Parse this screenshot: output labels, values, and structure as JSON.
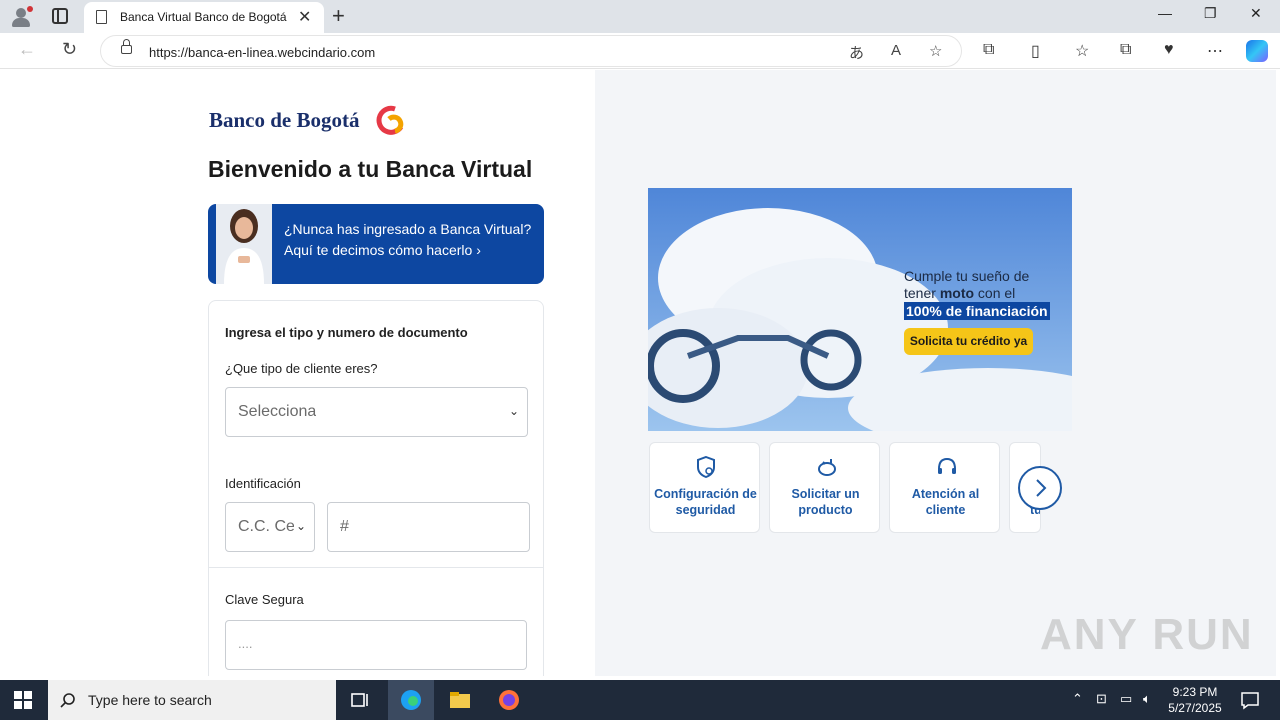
{
  "browser": {
    "tab_title": "Banca Virtual Banco de Bogotá",
    "url": "https://banca-en-linea.webcindario.com"
  },
  "page": {
    "logo_text": "Banco de Bogotá",
    "welcome": "Bienvenido a tu Banca Virtual",
    "promo": {
      "line1": "¿Nunca has ingresado a Banca Virtual?",
      "line2": "Aquí te decimos cómo hacerlo ›"
    },
    "form": {
      "title": "Ingresa el tipo y numero de documento",
      "client_type_label": "¿Que tipo de cliente eres?",
      "client_type_value": "Selecciona",
      "id_label": "Identificación",
      "id_type_value": "C.C. Ce",
      "id_number_placeholder": "#",
      "password_label": "Clave Segura",
      "password_placeholder": "...."
    },
    "banner": {
      "line1": "Cumple tu sueño de",
      "line2_pre": "tener ",
      "line2_bold": "moto",
      "line2_post": " con el",
      "line3": "100% de financiación",
      "cta": "Solicita tu crédito ya"
    },
    "quick_links": [
      {
        "label": "Configuración de seguridad",
        "icon": "shield-icon"
      },
      {
        "label": "Solicitar un producto",
        "icon": "piggy-bank-icon"
      },
      {
        "label": "Atención al cliente",
        "icon": "headset-icon"
      },
      {
        "label": "tu",
        "icon": "partial-card"
      }
    ],
    "watermark": "ANY RUN"
  },
  "taskbar": {
    "search_placeholder": "Type here to search",
    "time": "9:23 PM",
    "date": "5/27/2025"
  }
}
